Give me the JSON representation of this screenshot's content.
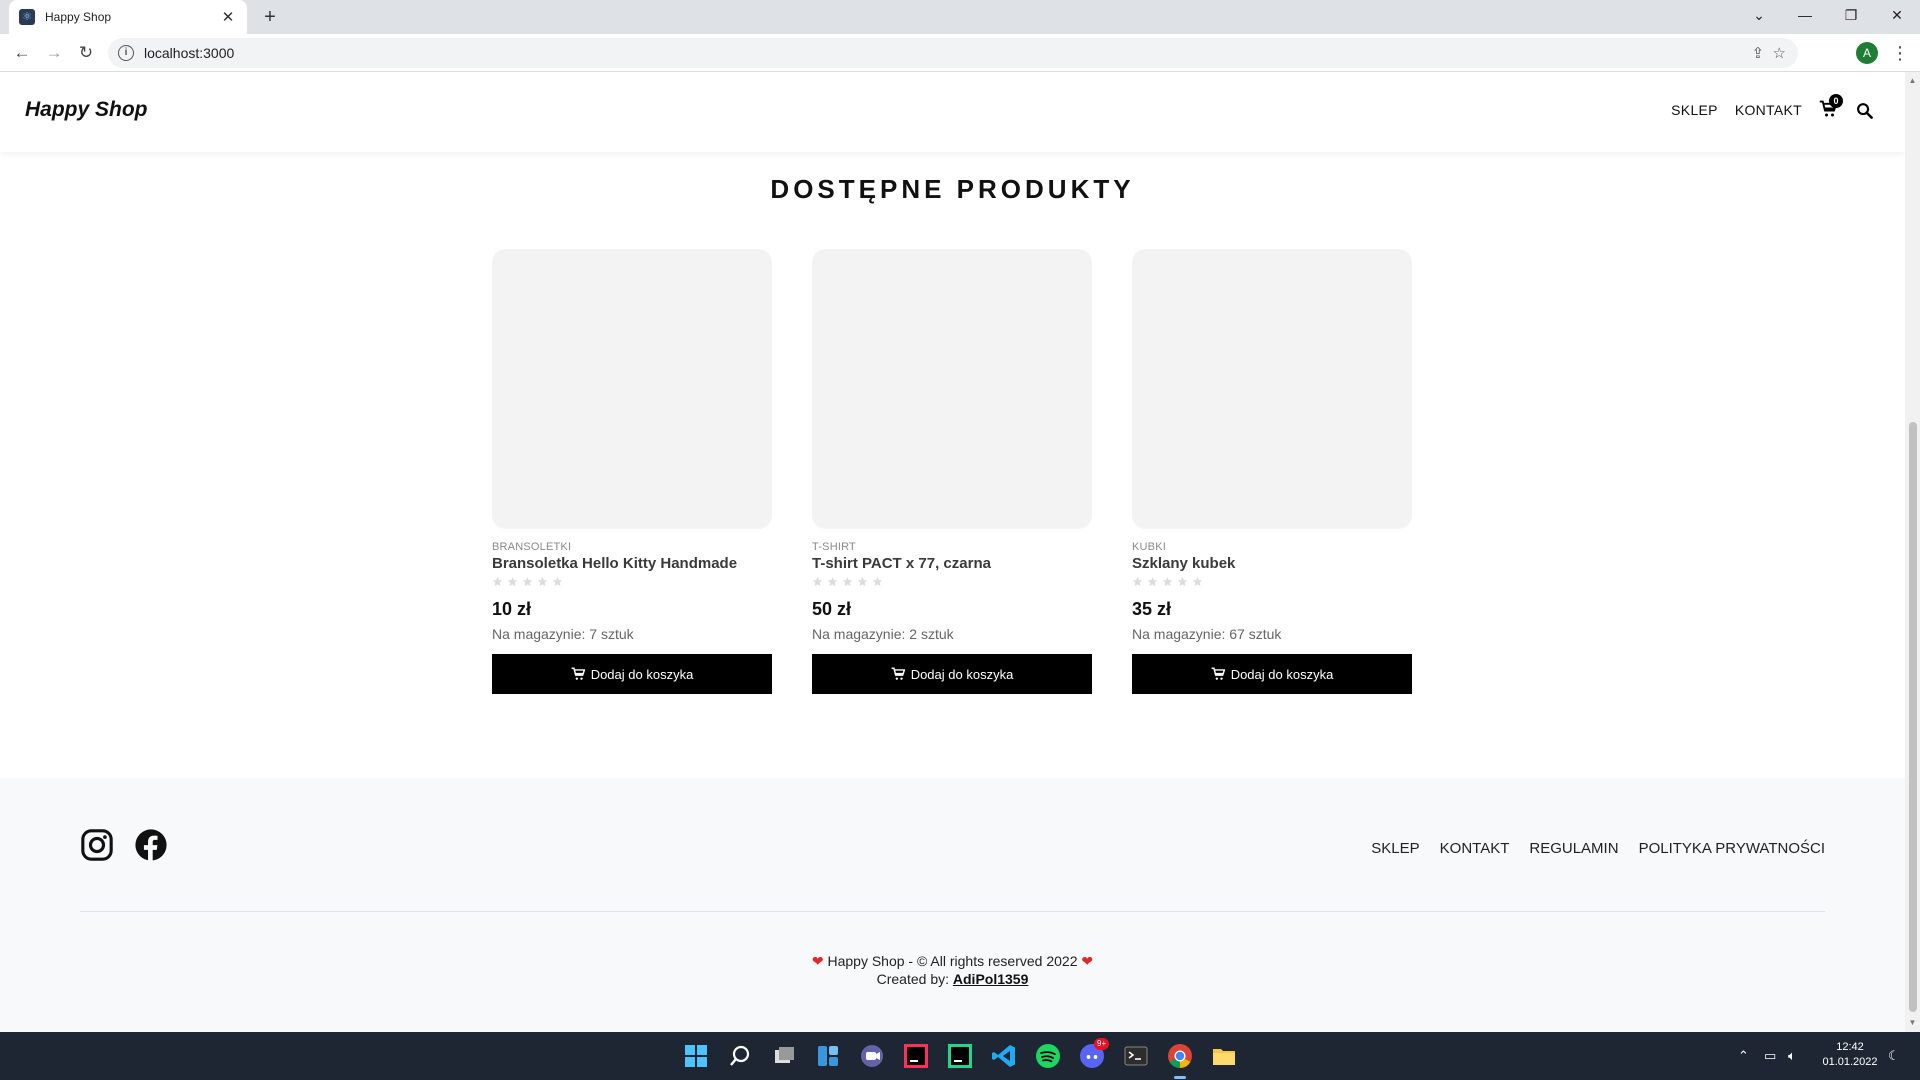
{
  "browser": {
    "tab_title": "Happy Shop",
    "url": "localhost:3000",
    "profile_initial": "A"
  },
  "header": {
    "logo": "Happy Shop",
    "nav": [
      "SKLEP",
      "KONTAKT"
    ],
    "cart_count": "0"
  },
  "main": {
    "section_title": "DOSTĘPNE PRODUKTY",
    "products": [
      {
        "category": "BRANSOLETKI",
        "name": "Bransoletka Hello Kitty Handmade",
        "rating": 0,
        "price": "10 zł",
        "stock": "Na magazynie: 7 sztuk",
        "button": "Dodaj do koszyka"
      },
      {
        "category": "T-SHIRT",
        "name": "T-shirt PACT x 77, czarna",
        "rating": 0,
        "price": "50 zł",
        "stock": "Na magazynie: 2 sztuk",
        "button": "Dodaj do koszyka"
      },
      {
        "category": "KUBKI",
        "name": "Szklany kubek",
        "rating": 0,
        "price": "35 zł",
        "stock": "Na magazynie: 67 sztuk",
        "button": "Dodaj do koszyka"
      }
    ]
  },
  "footer": {
    "social": [
      "instagram-icon",
      "facebook-icon"
    ],
    "links": [
      "SKLEP",
      "KONTAKT",
      "REGULAMIN",
      "POLITYKA PRYWATNOŚCI"
    ],
    "copyright": "Happy Shop - © All rights reserved 2022",
    "created_by_label": "Created by:",
    "author": "AdiPol1359"
  },
  "taskbar": {
    "time": "12:42",
    "date": "01.01.2022",
    "discord_badge": "9+"
  },
  "colors": {
    "accent": "#000000",
    "heart": "#e32626",
    "card_placeholder": "#f3f3f3",
    "footer_bg": "#f8f9fa",
    "taskbar_bg": "#1f2633"
  }
}
